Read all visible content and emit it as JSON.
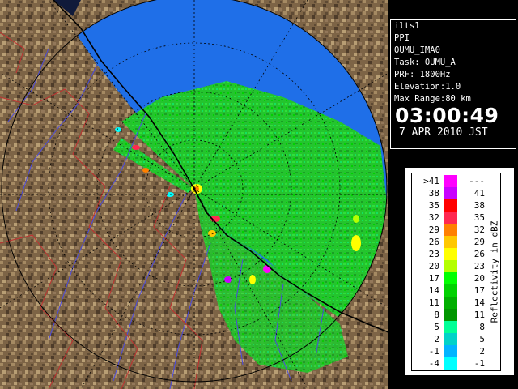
{
  "info": {
    "station": "ilts1",
    "scan_type": "PPI",
    "site_id": "OUMU_IMA0",
    "task": "Task: OUMU_A",
    "prf": "PRF: 1800Hz",
    "elevation": "Elevation:1.0",
    "max_range": "Max Range:80 km",
    "time": "03:00:49",
    "date": "7 APR 2010 JST"
  },
  "legend": {
    "title": "Reflectivity in dBZ",
    "rows": [
      {
        "min": ">41",
        "max": "---",
        "color": "#ff00ff"
      },
      {
        "min": "38",
        "max": "41",
        "color": "#c800ff"
      },
      {
        "min": "35",
        "max": "38",
        "color": "#ff0000"
      },
      {
        "min": "32",
        "max": "35",
        "color": "#ff2850"
      },
      {
        "min": "29",
        "max": "32",
        "color": "#ff8000"
      },
      {
        "min": "26",
        "max": "29",
        "color": "#ffc800"
      },
      {
        "min": "23",
        "max": "26",
        "color": "#ffff00"
      },
      {
        "min": "20",
        "max": "23",
        "color": "#b4ff00"
      },
      {
        "min": "17",
        "max": "20",
        "color": "#00ff00"
      },
      {
        "min": "14",
        "max": "17",
        "color": "#00d200"
      },
      {
        "min": "11",
        "max": "14",
        "color": "#00af00"
      },
      {
        "min": "8",
        "max": "11",
        "color": "#009600"
      },
      {
        "min": "5",
        "max": "8",
        "color": "#00ff96"
      },
      {
        "min": "2",
        "max": "5",
        "color": "#00d2c8"
      },
      {
        "min": "-1",
        "max": "2",
        "color": "#00b4ff"
      },
      {
        "min": "-4",
        "max": "-1",
        "color": "#00ffff"
      }
    ]
  },
  "colors": {
    "sea": "#1f6fe8",
    "land": "#7a6245",
    "echo": "#22c92e",
    "range_ring": "#000000",
    "coastline": "#000000",
    "rivers": "#4a4ae0",
    "borders": "#c03030"
  }
}
